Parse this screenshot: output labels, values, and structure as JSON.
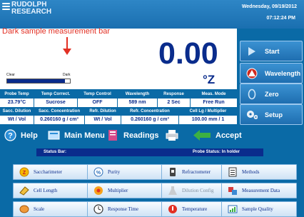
{
  "header": {
    "brand_line1": "RUDOLPH",
    "brand_line2": "RESEARCH",
    "date": "Wednesday, 09/19/2012",
    "time": "07:12:24 PM"
  },
  "measurement": {
    "annotation": "Dark sample measurement bar",
    "clear_label": "Clear",
    "dark_label": "Dark",
    "bar_level_fraction": 0.92,
    "reading": "0.00",
    "unit": "°Z"
  },
  "params": {
    "row1_headers": [
      "Probe Temp",
      "Temp Correct.",
      "Temp Control",
      "Wavelength",
      "Response",
      "Meas. Mode"
    ],
    "row1_values": [
      "23.79°C",
      "Sucrose",
      "OFF",
      "589 nm",
      "2 Sec",
      "Free Run"
    ],
    "row2_headers": [
      "Sacc. Dilution",
      "Sacc. Concentration",
      "Refr. Dilution",
      "Refr. Concentration",
      "Cell Lg / Multiplier"
    ],
    "row2_values": [
      "Wt / Vol",
      "0.260160 g / cm³",
      "Wt / Vol",
      "0.260160 g / cm³",
      "100.00 mm / 1"
    ]
  },
  "side_buttons": [
    {
      "label": "Start",
      "icon": "play-icon"
    },
    {
      "label": "Wavelength",
      "icon": "wavelength-icon"
    },
    {
      "label": "Zero",
      "icon": "zero-icon"
    },
    {
      "label": "Setup",
      "icon": "gears-icon"
    }
  ],
  "toolbar": {
    "help": "Help",
    "main_menu": "Main Menu",
    "readings": "Readings",
    "accept": "Accept"
  },
  "status": {
    "left": "Status Bar:",
    "right": "Probe Status: In holder"
  },
  "apps": [
    {
      "label": "Saccharimeter",
      "icon": "saccharimeter-icon",
      "enabled": true
    },
    {
      "label": "Purity",
      "icon": "purity-icon",
      "enabled": true
    },
    {
      "label": "Refractometer",
      "icon": "refractometer-icon",
      "enabled": true
    },
    {
      "label": "Methods",
      "icon": "methods-icon",
      "enabled": true
    },
    {
      "label": "Cell Length",
      "icon": "cell-length-icon",
      "enabled": true
    },
    {
      "label": "Multiplier",
      "icon": "multiplier-icon",
      "enabled": true
    },
    {
      "label": "Dilution Config",
      "icon": "dilution-icon",
      "enabled": false
    },
    {
      "label": "Measurement Data",
      "icon": "measurement-data-icon",
      "enabled": true
    },
    {
      "label": "Scale",
      "icon": "scale-icon",
      "enabled": true
    },
    {
      "label": "Response Time",
      "icon": "clock-icon",
      "enabled": true
    },
    {
      "label": "Temperature",
      "icon": "thermometer-icon",
      "enabled": true
    },
    {
      "label": "Sample Quality",
      "icon": "sample-quality-icon",
      "enabled": true
    }
  ],
  "colors": {
    "accent": "#0a2c8c",
    "background": "#0a6aa6",
    "annotation": "#e23024",
    "accept": "#3cb043"
  }
}
